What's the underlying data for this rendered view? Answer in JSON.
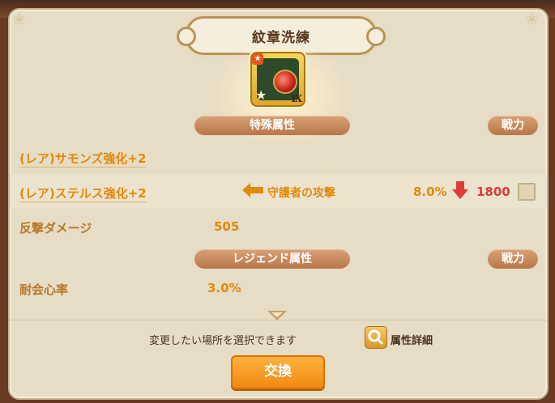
{
  "dialog": {
    "title": "紋章洗練",
    "emblem": {
      "rank": "Ⅸ",
      "icon": "emblem-icon"
    },
    "special_section": {
      "label": "特殊属性",
      "power_label": "戦力"
    },
    "special_attrs": [
      {
        "label": "(レア)サモンズ強化+2"
      },
      {
        "label": "(レア)ステルス強化+2",
        "target": "守護者の攻撃",
        "percent": "8.0%",
        "power": "1800"
      }
    ],
    "counter": {
      "label": "反撃ダメージ",
      "value": "505"
    },
    "legend_section": {
      "label": "レジェンド属性",
      "power_label": "戦力"
    },
    "legend_attrs": [
      {
        "label": "耐会心率",
        "value": "3.0%"
      }
    ],
    "footer": {
      "info": "変更したい場所を選択できます",
      "detail_label": "属性詳細",
      "exchange_label": "交換"
    }
  },
  "colors": {
    "accent": "#f08a12",
    "down": "#e03a3a",
    "label": "#e08a0c"
  }
}
